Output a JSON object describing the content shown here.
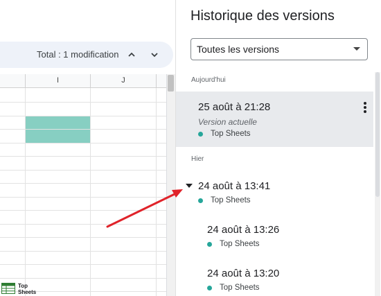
{
  "sheet": {
    "change_summary": "Total : 1 modification",
    "columns": [
      "I",
      "J"
    ],
    "highlight_color": "#87cfc2",
    "brand": {
      "line1": "Top",
      "line2": "Sheets"
    }
  },
  "panel": {
    "title": "Historique des versions",
    "filter": {
      "selected": "Toutes les versions"
    },
    "sections": [
      {
        "label": "Aujourd'hui",
        "versions": [
          {
            "date": "25 août à 21:28",
            "subtitle": "Version actuelle",
            "author": "Top Sheets"
          }
        ]
      },
      {
        "label": "Hier",
        "versions": [
          {
            "date": "24 août à 13:41",
            "author": "Top Sheets"
          },
          {
            "date": "24 août à 13:26",
            "author": "Top Sheets"
          },
          {
            "date": "24 août à 13:20",
            "author": "Top Sheets"
          }
        ]
      }
    ],
    "author_dot_color": "#26a69a"
  },
  "annotation": {
    "arrow_color": "#e0232a"
  }
}
